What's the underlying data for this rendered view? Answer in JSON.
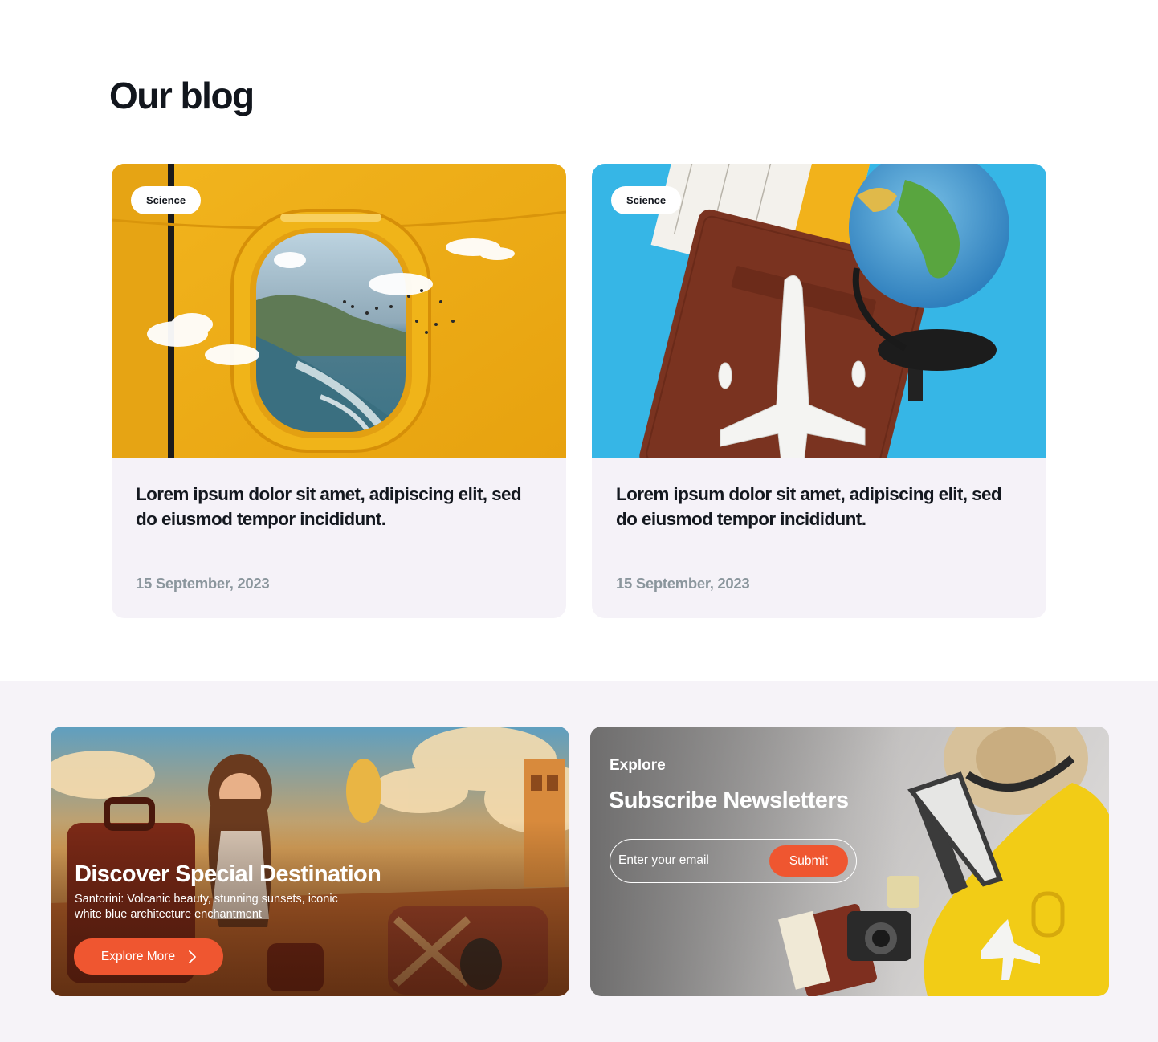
{
  "blog": {
    "title": "Our blog",
    "cards": [
      {
        "tag": "Science",
        "title": "Lorem ipsum dolor sit amet, adipiscing elit, sed do eiusmod tempor incididunt.",
        "date": "15 September, 2023"
      },
      {
        "tag": "Science",
        "title": "Lorem ipsum dolor sit amet, adipiscing elit, sed do eiusmod tempor incididunt.",
        "date": "15 September, 2023"
      }
    ]
  },
  "promo": {
    "title": "Discover Special Destination",
    "description": "Santorini: Volcanic beauty, stunning sunsets, iconic white blue  architecture enchantment",
    "button_label": "Explore More"
  },
  "newsletter": {
    "eyebrow": "Explore",
    "title": "Subscribe Newsletters",
    "email_placeholder": "Enter your email",
    "submit_label": "Submit"
  },
  "colors": {
    "accent": "#ef5630",
    "card_bg": "#f5f2f8",
    "section_bg": "#f6f3f8",
    "date_text": "#8b969d"
  },
  "icons": {
    "explore_button": "chevron-right-icon"
  }
}
